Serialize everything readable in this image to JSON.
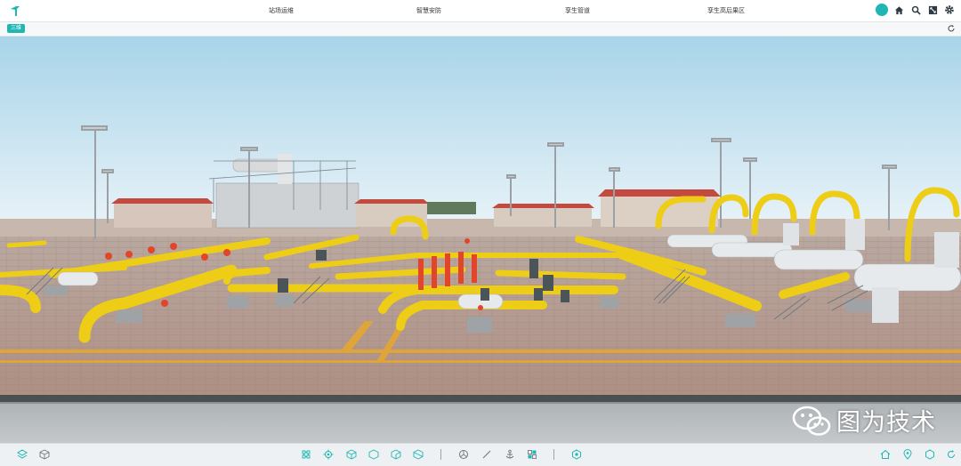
{
  "nav": {
    "items": [
      "站场运维",
      "智慧安防",
      "孪生管道",
      "孪生高后果区"
    ]
  },
  "subbar": {
    "mode_label": "三维"
  },
  "watermark": {
    "text": "图为技术"
  },
  "colors": {
    "accent": "#1fb7b3",
    "pipe_yellow": "#f2d21b",
    "valve_red": "#e2452a",
    "sky_top": "#a9d5ea",
    "ground": "#b69a8e"
  },
  "icons": {
    "top": [
      "user-avatar",
      "home-icon",
      "search-icon",
      "fullscreen-icon",
      "settings-icon"
    ],
    "bottom_left": [
      "layers-icon",
      "cube-icon"
    ],
    "bottom_center": [
      "tree-icon",
      "locate-icon",
      "cube-icon",
      "cube-outline-icon",
      "cube-side-icon",
      "cube-section-icon",
      "measure-icon",
      "line-icon",
      "anchor-icon",
      "grid-icon",
      "hexagon-icon"
    ],
    "bottom_right": [
      "home-icon",
      "map-pin-icon",
      "hexagon-outline-icon",
      "rotate-icon"
    ]
  }
}
